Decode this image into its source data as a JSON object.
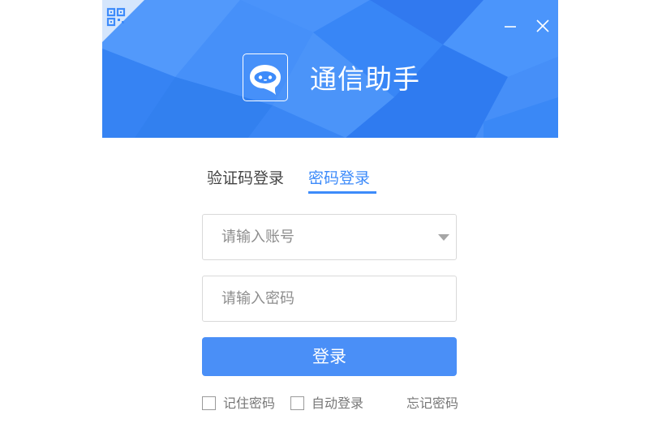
{
  "app": {
    "title": "通信助手"
  },
  "window_controls": {
    "minimize_icon": "minimize-icon",
    "close_icon": "close-icon"
  },
  "header": {
    "qr_icon": "qr-code-icon",
    "logo_icon": "chat-bubble-icon",
    "color": "#3d8bfa"
  },
  "tabs": [
    {
      "label": "验证码登录",
      "active": false
    },
    {
      "label": "密码登录",
      "active": true
    }
  ],
  "form": {
    "account": {
      "placeholder": "请输入账号",
      "value": ""
    },
    "password": {
      "placeholder": "请输入密码",
      "value": ""
    },
    "login_label": "登录",
    "remember_label": "记住密码",
    "remember_checked": false,
    "auto_login_label": "自动登录",
    "auto_login_checked": false,
    "forgot_label": "忘记密码"
  },
  "colors": {
    "accent": "#3d8bfa",
    "button": "#4a8ff7"
  }
}
